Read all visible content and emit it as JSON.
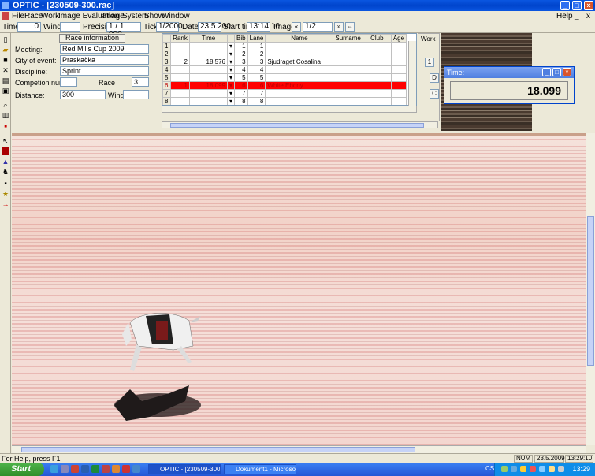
{
  "window": {
    "title": "OPTIC - [230509-300.rac]"
  },
  "menu": [
    "File",
    "Race",
    "Work",
    "Image Evaluation",
    "Image",
    "System",
    "Show",
    "Window"
  ],
  "menu_right": [
    "Help",
    "_",
    "x"
  ],
  "toolbar": {
    "time_label": "Time:",
    "time_value": "0",
    "wind_label": "Wind:",
    "wind_value": "",
    "precision_label": "Precision:",
    "precision_value": "1 / 1 000",
    "tick_label": "Tick:",
    "tick_value": "1/2000",
    "date_label": "Date:",
    "date_value": "23.5.200",
    "start_label": "Start time",
    "start_value": "13:14:10",
    "image_label": "Image:",
    "image_value": "1/2"
  },
  "race_info": {
    "header": "Race information",
    "meeting_label": "Meeting:",
    "meeting": "Red Mills Cup 2009",
    "city_label": "City of event:",
    "city": "Praskačka",
    "discipline_label": "Discipline:",
    "discipline": "Sprint",
    "competition_label": "Competion number:",
    "competition": "",
    "race_label": "Race",
    "race": "3",
    "distance_label": "Distance:",
    "distance": "300",
    "wind_label": "Wind:",
    "wind": ""
  },
  "grid": {
    "columns": [
      "",
      "Rank",
      "Time",
      "",
      "Bib",
      "Lane",
      "Name",
      "Surname",
      "Club",
      "Age"
    ],
    "rows": [
      {
        "n": "1",
        "rank": "",
        "time": "",
        "bib": "1",
        "lane": "1",
        "name": ""
      },
      {
        "n": "2",
        "rank": "",
        "time": "",
        "bib": "2",
        "lane": "2",
        "name": ""
      },
      {
        "n": "3",
        "rank": "2",
        "time": "18.576",
        "bib": "3",
        "lane": "3",
        "name": "Sjudraget Cosalina"
      },
      {
        "n": "4",
        "rank": "",
        "time": "",
        "bib": "4",
        "lane": "4",
        "name": ""
      },
      {
        "n": "5",
        "rank": "",
        "time": "",
        "bib": "5",
        "lane": "5",
        "name": ""
      },
      {
        "n": "6",
        "rank": "1",
        "time": "18.099",
        "bib": "6",
        "lane": "6",
        "name": "White Ebony"
      },
      {
        "n": "7",
        "rank": "",
        "time": "",
        "bib": "7",
        "lane": "7",
        "name": ""
      },
      {
        "n": "8",
        "rank": "",
        "time": "",
        "bib": "8",
        "lane": "8",
        "name": ""
      }
    ]
  },
  "work_panel": {
    "label": "Work"
  },
  "time_popup": {
    "title": "Time:",
    "value": "18.099"
  },
  "status": {
    "help": "For Help, press F1",
    "num": "NUM",
    "date": "23.5.2009",
    "time": "13:29:10"
  },
  "taskbar": {
    "start": "Start",
    "tasks": [
      "OPTIC - [230509-300...",
      "Dokument1 - Microsof..."
    ],
    "lang": "CS",
    "clock": "13:29"
  },
  "colors": {
    "selected_row": "#ff0000",
    "title_bar": "#0a56e0",
    "taskbar": "#2456d6"
  }
}
